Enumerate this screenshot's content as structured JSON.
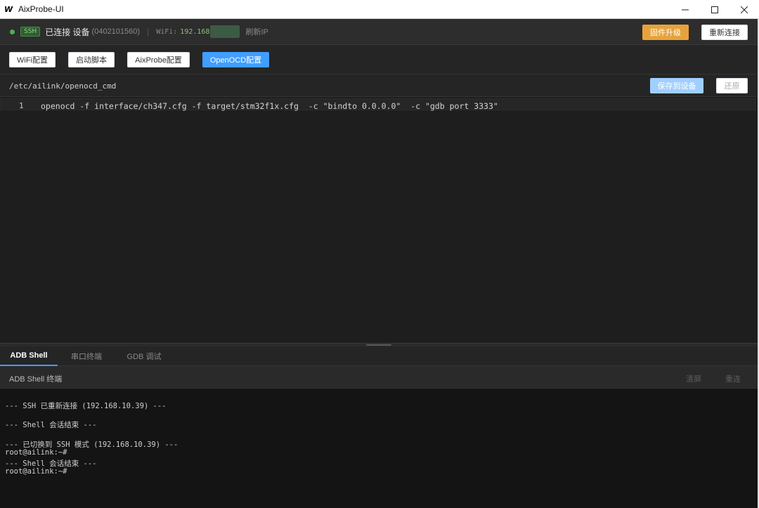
{
  "app": {
    "title": "AixProbe-UI",
    "logo_text": "W"
  },
  "status": {
    "ssh_badge": "SSH",
    "connection_text": "已连接 设备",
    "device_id": "(0402101560)",
    "separator": "|",
    "wifi_label": "WiFi:",
    "wifi_ip_visible": "192.168",
    "refresh_ip_label": "刷新IP",
    "firmware_upgrade_label": "固件升级",
    "reconnect_label": "重新连接",
    "connected_color": "#4caf50"
  },
  "config_tabs": [
    {
      "label": "WiFi配置",
      "active": false
    },
    {
      "label": "启动脚本",
      "active": false
    },
    {
      "label": "AixProbe配置",
      "active": false
    },
    {
      "label": "OpenOCD配置",
      "active": true
    }
  ],
  "file": {
    "path": "/etc/ailink/openocd_cmd",
    "save_label": "保存到设备",
    "restore_label": "还原"
  },
  "editor": {
    "lines": [
      {
        "number": "1",
        "code": "openocd -f interface/ch347.cfg -f target/stm32f1x.cfg  -c \"bindto 0.0.0.0\"  -c \"gdb port 3333\""
      }
    ]
  },
  "bottom_tabs": [
    {
      "label": "ADB Shell",
      "active": true
    },
    {
      "label": "串口终端",
      "active": false
    },
    {
      "label": "GDB 调试",
      "active": false
    }
  ],
  "terminal": {
    "title": "ADB Shell 终端",
    "clear_label": "清屏",
    "reconnect_label": "重连",
    "lines": [
      "--- SSH 已重新连接 (192.168.10.39) ---",
      "",
      "--- Shell 会话结束 ---",
      "",
      "--- 已切换到 SSH 模式 (192.168.10.39) ---",
      "root@ailink:~#",
      "--- Shell 会话结束 ---",
      "root@ailink:~#"
    ]
  },
  "colors": {
    "accent": "#409eff",
    "warning": "#e6a23c",
    "background": "#1e1e1e"
  }
}
